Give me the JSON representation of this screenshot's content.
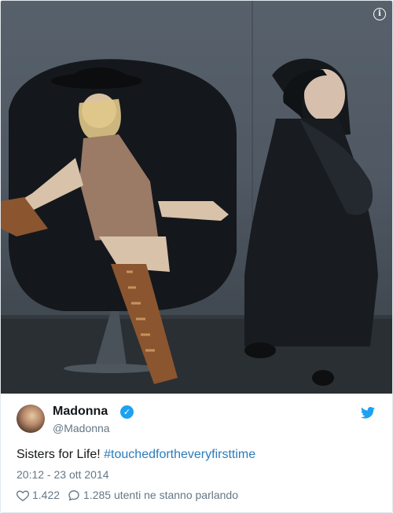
{
  "tweet": {
    "author_name": "Madonna",
    "handle": "@Madonna",
    "text_plain": "Sisters for Life! ",
    "hashtag": "#touchedfortheveryfirsttime",
    "timestamp": "20:12 - 23 ott 2014",
    "likes": "1.422",
    "talking": "1.285 utenti ne stanno parlando"
  },
  "icons": {
    "info": "info-icon",
    "verified": "verified-badge-icon",
    "twitter": "twitter-bird-icon",
    "like": "heart-icon",
    "reply": "speech-bubble-icon"
  },
  "colors": {
    "link": "#2b7bb9",
    "verified": "#1da1f2",
    "secondary_text": "#657786",
    "primary_text": "#14171a"
  }
}
